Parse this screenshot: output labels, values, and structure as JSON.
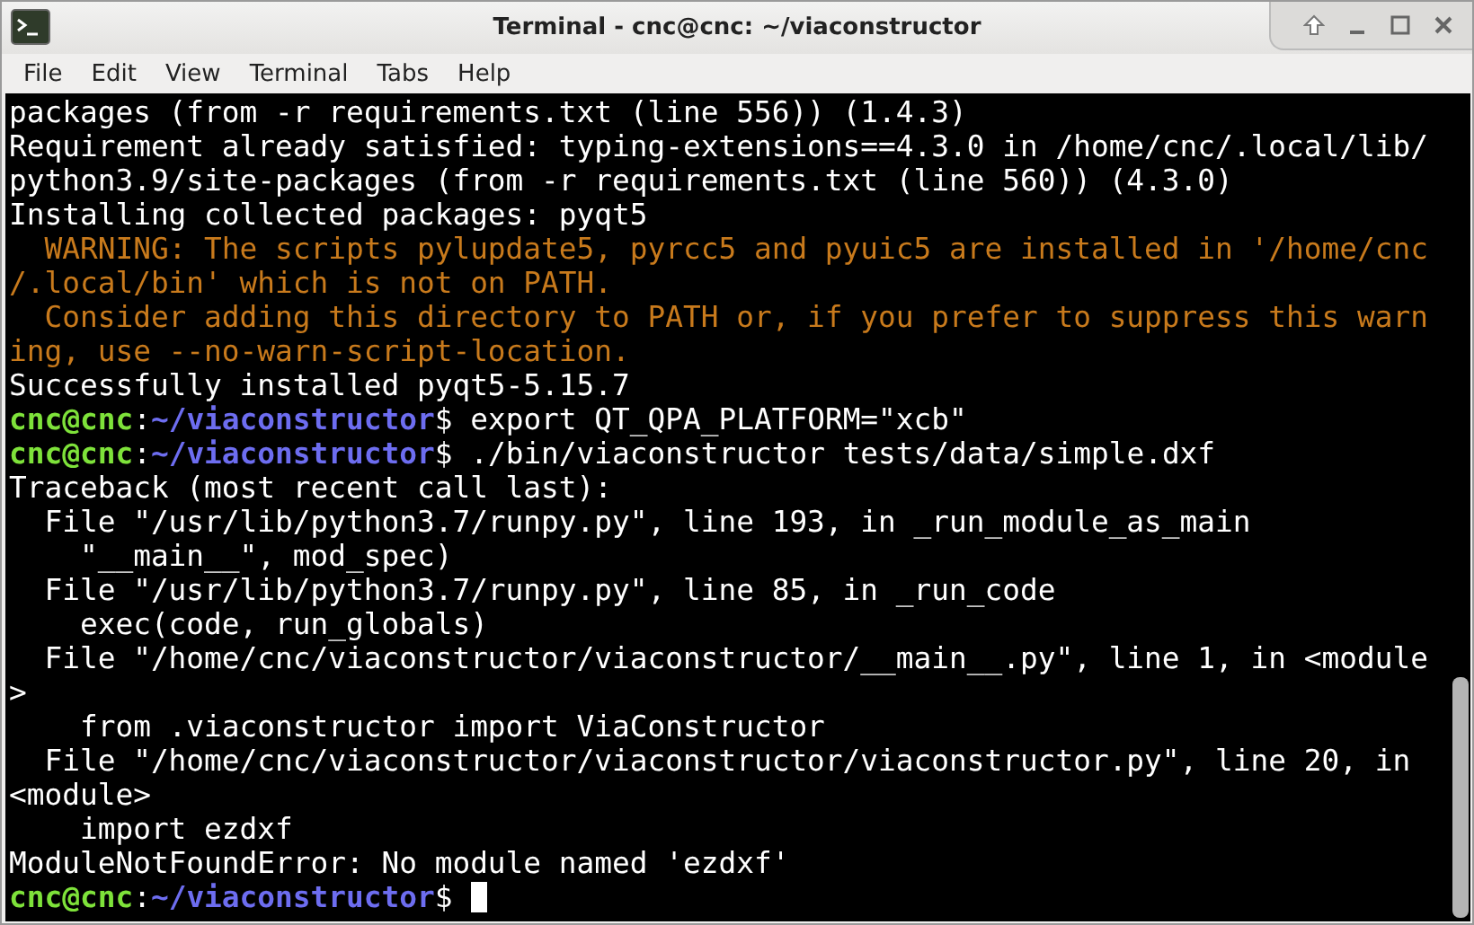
{
  "window": {
    "title": "Terminal - cnc@cnc: ~/viaconstructor"
  },
  "menu": [
    "File",
    "Edit",
    "View",
    "Terminal",
    "Tabs",
    "Help"
  ],
  "lines": [
    {
      "kind": "plain",
      "text": "packages (from -r requirements.txt (line 556)) (1.4.3)"
    },
    {
      "kind": "plain",
      "text": "Requirement already satisfied: typing-extensions==4.3.0 in /home/cnc/.local/lib/"
    },
    {
      "kind": "plain",
      "text": "python3.9/site-packages (from -r requirements.txt (line 560)) (4.3.0)"
    },
    {
      "kind": "plain",
      "text": "Installing collected packages: pyqt5"
    },
    {
      "kind": "warning",
      "text": "  WARNING: The scripts pylupdate5, pyrcc5 and pyuic5 are installed in '/home/cnc"
    },
    {
      "kind": "warning",
      "text": "/.local/bin' which is not on PATH."
    },
    {
      "kind": "warning",
      "text": "  Consider adding this directory to PATH or, if you prefer to suppress this warn"
    },
    {
      "kind": "warning",
      "text": "ing, use --no-warn-script-location."
    },
    {
      "kind": "plain",
      "text": "Successfully installed pyqt5-5.15.7"
    },
    {
      "kind": "prompt",
      "user": "cnc@cnc",
      "sep": ":",
      "path": "~/viaconstructor",
      "sign": "$",
      "command": " export QT_QPA_PLATFORM=\"xcb\""
    },
    {
      "kind": "prompt",
      "user": "cnc@cnc",
      "sep": ":",
      "path": "~/viaconstructor",
      "sign": "$",
      "command": " ./bin/viaconstructor tests/data/simple.dxf"
    },
    {
      "kind": "plain",
      "text": "Traceback (most recent call last):"
    },
    {
      "kind": "plain",
      "text": "  File \"/usr/lib/python3.7/runpy.py\", line 193, in _run_module_as_main"
    },
    {
      "kind": "plain",
      "text": "    \"__main__\", mod_spec)"
    },
    {
      "kind": "plain",
      "text": "  File \"/usr/lib/python3.7/runpy.py\", line 85, in _run_code"
    },
    {
      "kind": "plain",
      "text": "    exec(code, run_globals)"
    },
    {
      "kind": "plain",
      "text": "  File \"/home/cnc/viaconstructor/viaconstructor/__main__.py\", line 1, in <module"
    },
    {
      "kind": "plain",
      "text": ">"
    },
    {
      "kind": "plain",
      "text": "    from .viaconstructor import ViaConstructor"
    },
    {
      "kind": "plain",
      "text": "  File \"/home/cnc/viaconstructor/viaconstructor/viaconstructor.py\", line 20, in "
    },
    {
      "kind": "plain",
      "text": "<module>"
    },
    {
      "kind": "plain",
      "text": "    import ezdxf"
    },
    {
      "kind": "plain",
      "text": "ModuleNotFoundError: No module named 'ezdxf'"
    },
    {
      "kind": "prompt",
      "user": "cnc@cnc",
      "sep": ":",
      "path": "~/viaconstructor",
      "sign": "$",
      "cursor": true
    }
  ]
}
